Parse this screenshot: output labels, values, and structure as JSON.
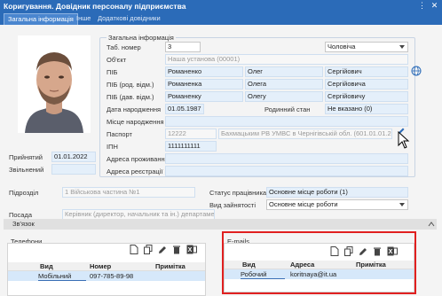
{
  "window": {
    "title": "Коригування. Довідник персоналу підприємства"
  },
  "tabs": [
    {
      "label": "Загальна інформація",
      "active": true
    },
    {
      "label": "Інше",
      "active": false
    },
    {
      "label": "Додаткові довідники",
      "active": false
    }
  ],
  "general": {
    "group_title": "Загальна інформація",
    "tab_number_label": "Таб. номер",
    "tab_number_value": "3",
    "gender_value": "Чоловіча",
    "object_label": "Об'єкт",
    "object_value": "Наша установа (00001)",
    "pib_label": "ПІБ",
    "pib": [
      "Романенко",
      "Олег",
      "Сергійович"
    ],
    "pib_gen_label": "ПІБ (род. відм.)",
    "pib_gen": [
      "Романенка",
      "Олега",
      "Сергійовича"
    ],
    "pib_dat_label": "ПІБ (дав. відм.)",
    "pib_dat": [
      "Романенку",
      "Олегу",
      "Сергійовичу"
    ],
    "birth_date_label": "Дата народження",
    "birth_date_value": "01.05.1987",
    "marital_label": "Родинний стан",
    "marital_value": "Не вказано (0)",
    "birth_place_label": "Місце народження",
    "passport_label": "Паспорт",
    "passport_number": "12222",
    "passport_issued": "Бахмацьким РВ УМВС в Чернігівській обл. (601.01.01.2010",
    "ipn_label": "ІПН",
    "ipn_value": "1111111111",
    "residence_label": "Адреса проживання",
    "registration_label": "Адреса реєстрації"
  },
  "employment": {
    "hired_label": "Прийнятий",
    "hired_value": "01.01.2022",
    "fired_label": "Звільнений",
    "division_label": "Підрозділ",
    "division_value": "1 Військова частина №1",
    "position_label": "Посада",
    "position_value": "Керівник (директор, начальник та ін.) департаменту (",
    "status_label": "Статус працівника",
    "status_value": "Основне місце роботи (1)",
    "employment_type_label": "Вид зайнятості",
    "employment_type_value": "Основне місце роботи"
  },
  "contacts": {
    "section_label": "Зв'язок",
    "phones": {
      "title": "Телефони",
      "headers": [
        "Вид",
        "Номер",
        "Примітка"
      ],
      "rows": [
        {
          "kind": "Мобільний",
          "number": "097-785-89-98",
          "note": ""
        }
      ]
    },
    "emails": {
      "title": "E-mails",
      "headers": [
        "Вид",
        "Адреса",
        "Примітка"
      ],
      "rows": [
        {
          "kind": "Робочий",
          "address": "koritnaya@it.ua",
          "note": ""
        }
      ]
    }
  },
  "colors": {
    "titlebar": "#2b6bb8",
    "field": "#e4effa",
    "highlight": "#e02020"
  },
  "icons": [
    "menu-icon",
    "close-icon",
    "globe-icon",
    "edit-pencil-icon",
    "new-file-icon",
    "copy-icon",
    "delete-icon",
    "excel-icon"
  ]
}
